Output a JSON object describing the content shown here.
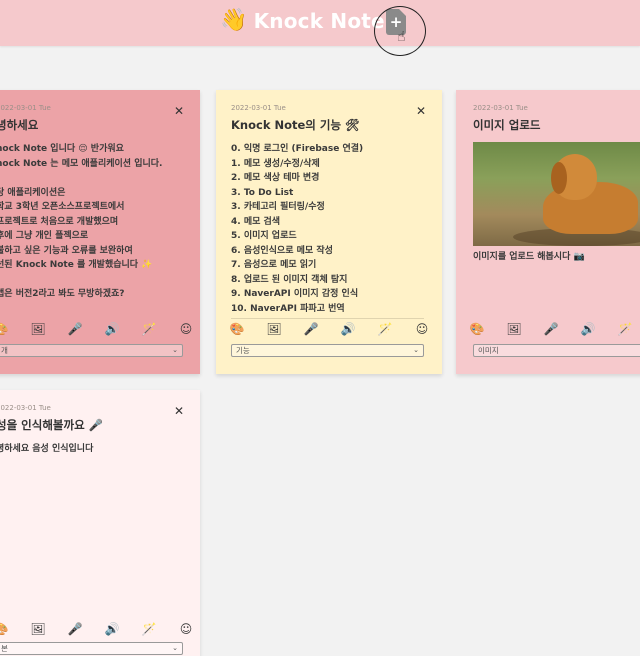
{
  "header": {
    "logo_emoji": "👋",
    "title": "Knock Note",
    "add_icon": "file-plus-icon",
    "bg_color": "#f5c9cc"
  },
  "toolbar_icons": [
    "palette-icon",
    "image-icon",
    "microphone-icon",
    "speaker-icon",
    "magic-wand-icon",
    "smile-icon",
    "translate-icon"
  ],
  "toolbar_glyphs": [
    "🎨",
    "🖼",
    "🎤",
    "🔊",
    "🪄",
    "☺",
    "🈯"
  ],
  "notes": [
    {
      "date": "2022-03-01 Tue",
      "title": "녕하세요",
      "body": "nock Note 입니다 😌 반가워요\nnock Note 는 메모 애플리케이션 입니다.\n\n당 애플리케이션은\n학교 3학년 오픈소스프로젝트에서\n프로젝트로 처음으로 개발했으며\n후에 그냥 개인 플젝으로\n불하고 싶은 기능과 오류를 보완하여\n선된 Knock Note 를 개발했습니다 ✨\n\n앱은 버전2라고 봐도 무방하겠죠?",
      "category": "개",
      "color": "#eca3a7"
    },
    {
      "date": "2022-03-01 Tue",
      "title": "Knock Note의 기능 🛠",
      "body": "0. 익명 로그인 (Firebase 연결)\n1. 메모 생성/수정/삭제\n2. 메모 색상 테마 변경\n3. To Do List\n3. 카테고리 필터링/수정\n4. 메모 검색\n5. 이미지 업로드\n6. 음성인식으로 메모 작성\n7. 음성으로 메모 읽기\n8. 업로드 된 이미지 객체 탐지\n9. NaverAPI 이미지 감정 인식\n10. NaverAPI 파파고 번역",
      "category": "기능",
      "color": "#fff2c8"
    },
    {
      "date": "2022-03-01 Tue",
      "title": "이미지 업로드",
      "body": "이미지를 업로드 해봅시다 📷",
      "category": "이미지",
      "color": "#f6c9cc"
    },
    {
      "date": "2022-03-01 Tue",
      "title": "성을 인식해볼까요 🎤",
      "body": "녕하세요 음성 인식입니다",
      "category": "본",
      "color": "#fff1f1"
    }
  ]
}
